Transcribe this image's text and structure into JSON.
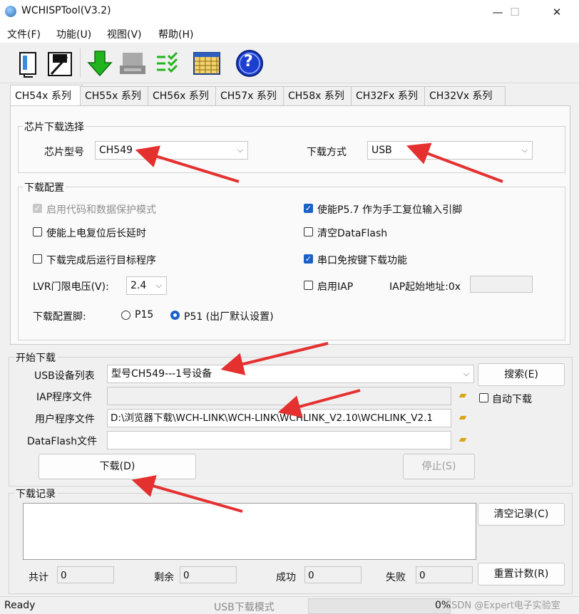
{
  "window": {
    "title": "WCHISPTool(V3.2)",
    "minimize": "—",
    "maximize": "☐",
    "close": "✕"
  },
  "menu": [
    {
      "label": "文件(F)"
    },
    {
      "label": "功能(U)"
    },
    {
      "label": "视图(V)"
    },
    {
      "label": "帮助(H)"
    }
  ],
  "toolbar": {
    "icons": [
      "open-file-icon",
      "save-file-icon",
      "download-icon",
      "device-icon",
      "check-list-icon",
      "calendar-grid-icon",
      "help-icon"
    ],
    "help_glyph": "?"
  },
  "tabs": [
    "CH54x 系列",
    "CH55x 系列",
    "CH56x 系列",
    "CH57x 系列",
    "CH58x 系列",
    "CH32Fx 系列",
    "CH32Vx 系列"
  ],
  "chip_select": {
    "legend": "芯片下载选择",
    "model_label": "芯片型号",
    "model_value": "CH549",
    "mode_label": "下载方式",
    "mode_value": "USB"
  },
  "config": {
    "legend": "下载配置",
    "enable_protect": "启用代码和数据保护模式",
    "p57_reset": "使能P5.7 作为手工复位输入引脚",
    "power_delay": "使能上电复位后长延时",
    "clear_dataflash": "清空DataFlash",
    "run_after": "下载完成后运行目标程序",
    "serial_free": "串口免按键下载功能",
    "lvr_label": "LVR门限电压(V):",
    "lvr_value": "2.4",
    "enable_iap": "启用IAP",
    "iap_addr_label": "IAP起始地址:0x",
    "iap_addr_value": "",
    "pin_label": "下载配置脚:",
    "pin_p15": "P15",
    "pin_p51": "P51 (出厂默认设置)"
  },
  "start": {
    "legend": "开始下载",
    "usb_list_label": "USB设备列表",
    "usb_list_value": "型号CH549---1号设备",
    "search_button": "搜索(E)",
    "iap_file_label": "IAP程序文件",
    "iap_file_value": "",
    "auto_download": "自动下载",
    "user_file_label": "用户程序文件",
    "user_file_value": "D:\\浏览器下载\\WCH-LINK\\WCH-LINK\\WCHLINK_V2.10\\WCHLINK_V2.1",
    "dataflash_label": "DataFlash文件",
    "dataflash_value": "",
    "download_button": "下载(D)",
    "stop_button": "停止(S)"
  },
  "log": {
    "legend": "下载记录",
    "clear_button": "清空记录(C)",
    "total_label": "共计",
    "total_value": "0",
    "remain_label": "剩余",
    "remain_value": "0",
    "success_label": "成功",
    "success_value": "0",
    "fail_label": "失败",
    "fail_value": "0",
    "reset_button": "重置计数(R)"
  },
  "status": {
    "state": "Ready",
    "mode": "USB下载模式",
    "progress": "0%",
    "progress_fraction": 0,
    "watermark": "CSDN @Expert电子实验室"
  },
  "colors": {
    "accent": "#1b62c6",
    "annotation_arrow": "#e53030",
    "toolbar_green": "#22b41e"
  }
}
